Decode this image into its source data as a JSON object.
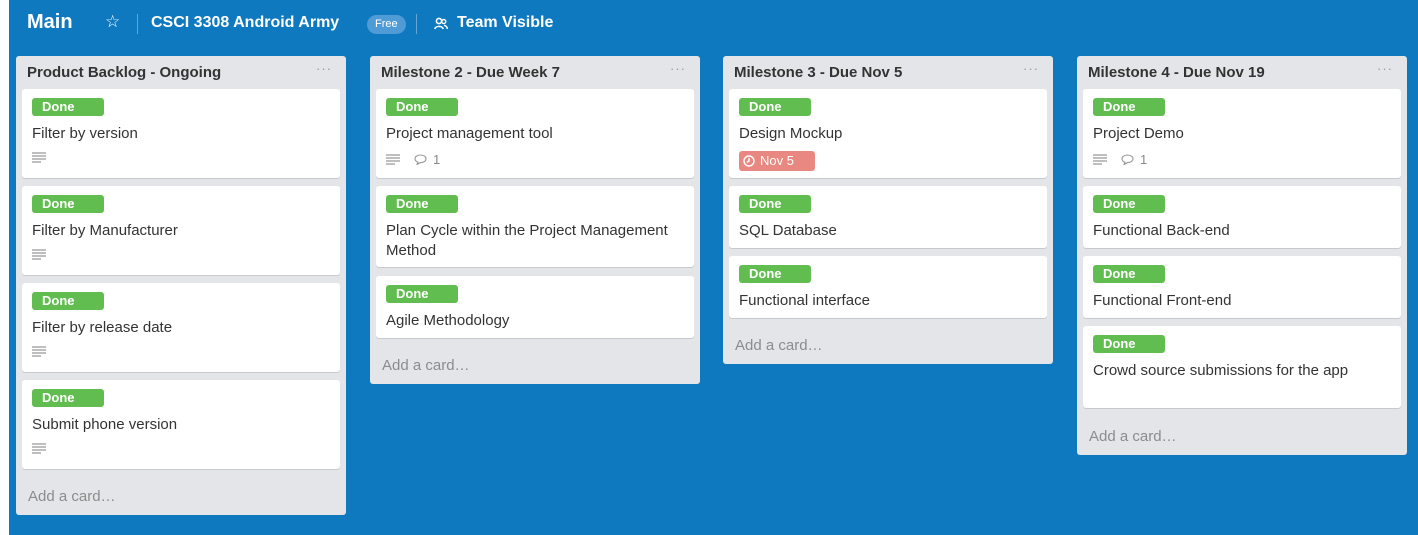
{
  "header": {
    "board_title": "Main",
    "team_name": "CSCI 3308 Android Army",
    "plan_badge": "Free",
    "visibility_label": "Team Visible"
  },
  "icons": {
    "star": "star-icon",
    "visibility": "team-icon",
    "description": "description-icon",
    "comment": "comment-icon",
    "clock": "clock-icon"
  },
  "colors": {
    "board_bg": "#0f79bf",
    "list_bg": "#e3e5e8",
    "label_green": "#61bd4f",
    "due_red": "#e98880"
  },
  "lists": [
    {
      "title": "Product Backlog - Ongoing",
      "menu": "···",
      "add_card": "Add a card…",
      "cards": [
        {
          "label": "Done",
          "title": "Filter by version",
          "has_description": true
        },
        {
          "label": "Done",
          "title": "Filter by Manufacturer",
          "has_description": true
        },
        {
          "label": "Done",
          "title": "Filter by release date",
          "has_description": true
        },
        {
          "label": "Done",
          "title": "Submit phone version",
          "has_description": true
        }
      ]
    },
    {
      "title": "Milestone 2 - Due Week 7",
      "menu": "···",
      "add_card": "Add a card…",
      "cards": [
        {
          "label": "Done",
          "title": "Project management tool",
          "has_description": true,
          "comments": "1"
        },
        {
          "label": "Done",
          "title": "Plan Cycle within the Project Management Method"
        },
        {
          "label": "Done",
          "title": "Agile Methodology"
        }
      ]
    },
    {
      "title": "Milestone 3 - Due Nov 5",
      "menu": "···",
      "add_card": "Add a card…",
      "cards": [
        {
          "label": "Done",
          "title": "Design Mockup",
          "due": "Nov 5"
        },
        {
          "label": "Done",
          "title": "SQL Database"
        },
        {
          "label": "Done",
          "title": "Functional interface"
        }
      ]
    },
    {
      "title": "Milestone 4 - Due Nov 19",
      "menu": "···",
      "add_card": "Add a card…",
      "cards": [
        {
          "label": "Done",
          "title": "Project Demo",
          "has_description": true,
          "comments": "1"
        },
        {
          "label": "Done",
          "title": "Functional Back-end"
        },
        {
          "label": "Done",
          "title": "Functional Front-end"
        },
        {
          "label": "Done",
          "title": "Crowd source submissions for the app"
        }
      ]
    }
  ]
}
